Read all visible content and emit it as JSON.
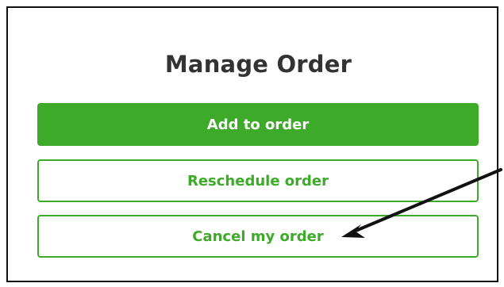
{
  "manage_order": {
    "title": "Manage Order",
    "buttons": {
      "add": "Add to order",
      "reschedule": "Reschedule order",
      "cancel": "Cancel my order"
    }
  },
  "colors": {
    "accent": "#3daa2a",
    "title": "#333333",
    "frame_border": "#111111",
    "arrow": "#111111"
  }
}
